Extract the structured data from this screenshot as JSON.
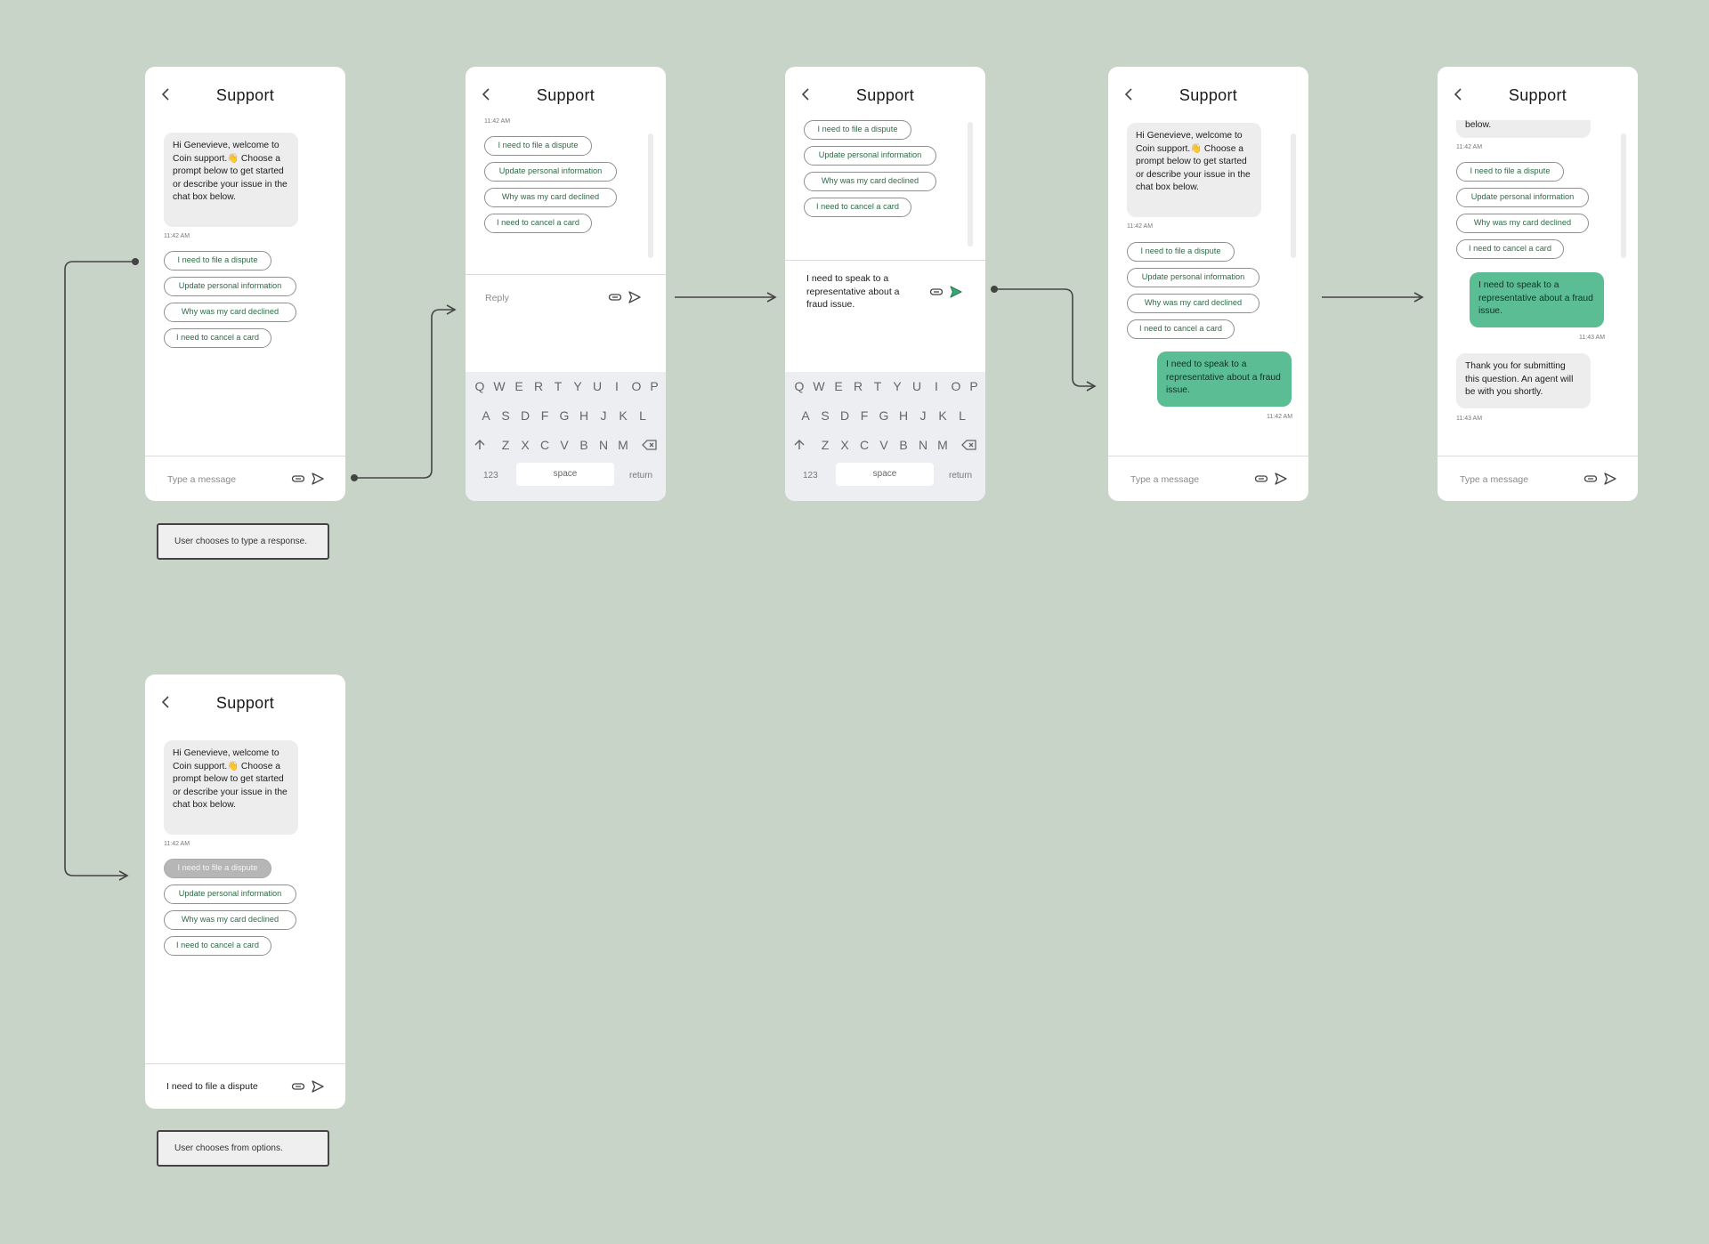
{
  "title": "Support",
  "welcome": "Hi Genevieve, welcome to Coin support.👋 Choose a prompt below to get started or describe your issue in the chat box below.",
  "welcome_tail": "below.",
  "time_1142": "11:42 AM",
  "time_1143": "11:43 AM",
  "prompts": [
    "I need to file a dispute",
    "Update personal information",
    "Why was my card declined",
    "I need to cancel a card"
  ],
  "composer_placeholder": "Type a message",
  "reply_placeholder": "Reply",
  "user_message": "I need to speak to a representative about a fraud issue.",
  "agent_reply": "Thank you for submitting this question. An agent will be with you shortly.",
  "selected_option_text": "I need to file a dispute",
  "keyboard": {
    "row1": [
      "Q",
      "W",
      "E",
      "R",
      "T",
      "Y",
      "U",
      "I",
      "O",
      "P"
    ],
    "row2": [
      "A",
      "S",
      "D",
      "F",
      "G",
      "H",
      "J",
      "K",
      "L"
    ],
    "row3": [
      "Z",
      "X",
      "C",
      "V",
      "B",
      "N",
      "M"
    ],
    "numbers": "123",
    "space": "space",
    "return": "return"
  },
  "notes": {
    "type_response": "User chooses to type a response.",
    "choose_options": "User chooses from options."
  },
  "icons": {
    "back": "chevron-left-icon",
    "attach": "paperclip-icon",
    "send": "send-icon",
    "shift": "shift-icon",
    "delete": "backspace-icon"
  },
  "colors": {
    "background": "#c9d4c8",
    "user_bubble": "#5bbd93",
    "chip_text": "#2e6b45",
    "send_active": "#3aa778"
  }
}
